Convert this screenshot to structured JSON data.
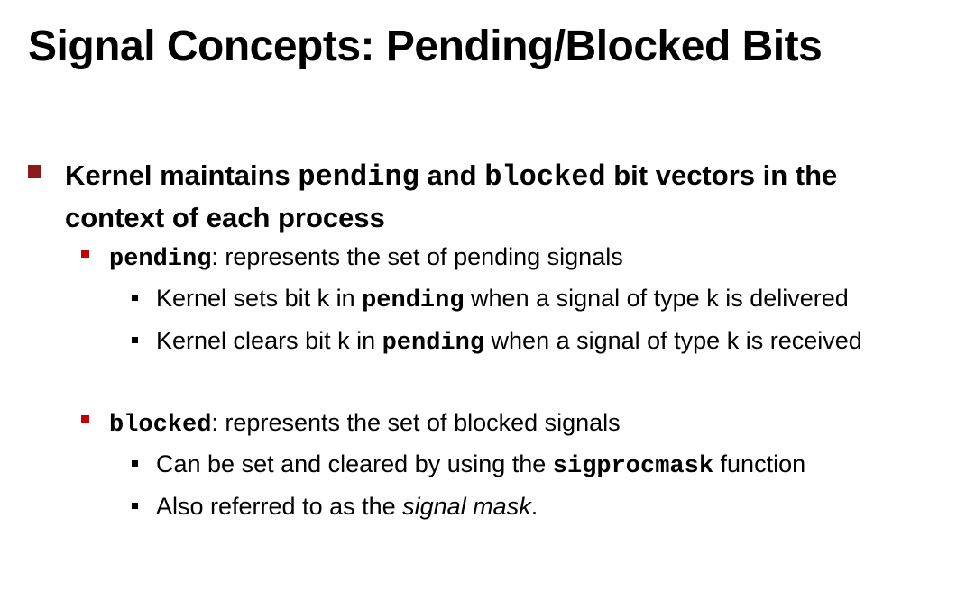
{
  "title": "Signal Concepts: Pending/Blocked Bits",
  "colors": {
    "bullet_level1": "#8b1a1a",
    "bullet_level2": "#c00000",
    "bullet_level3": "#000000"
  },
  "main_point": {
    "part1": "Kernel maintains ",
    "code1": "pending",
    "part2": " and ",
    "code2": "blocked",
    "part3": " bit vectors in the context of each process"
  },
  "pending_section": {
    "code": "pending",
    "text": ": represents the set of pending signals",
    "subitems": [
      {
        "before": "Kernel sets bit k in ",
        "code": "pending",
        "after": " when a signal of type k is delivered"
      },
      {
        "before": "Kernel clears bit k in ",
        "code": "pending",
        "after": " when a signal of type k is received"
      }
    ]
  },
  "blocked_section": {
    "code": "blocked",
    "text": ": represents the set of blocked signals",
    "subitems": [
      {
        "before": "Can be set and cleared by using the ",
        "code": "sigprocmask",
        "after": " function"
      },
      {
        "before": "Also referred to as the ",
        "emph": "signal mask",
        "after": "."
      }
    ]
  }
}
